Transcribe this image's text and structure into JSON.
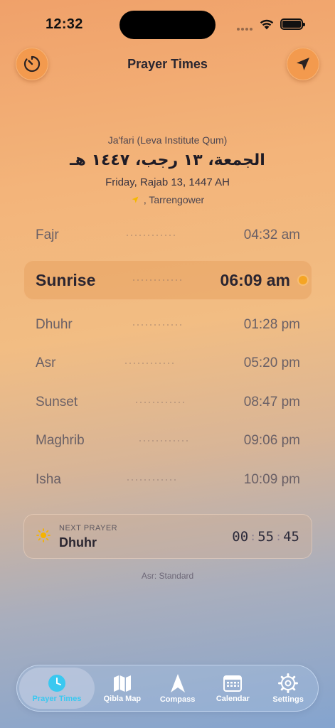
{
  "status_bar": {
    "time": "12:32"
  },
  "header": {
    "title": "Prayer Times",
    "timer_icon": "timer-icon",
    "locate_icon": "location-arrow-icon"
  },
  "info": {
    "method": "Ja'fari (Leva Institute Qum)",
    "hijri_arabic": "الجمعة، ١٣ رجب، ١٤٤٧ هـ",
    "gregorian": "Friday, Rajab 13, 1447 AH",
    "location": ", Tarrengower"
  },
  "prayers": [
    {
      "name": "Fajr",
      "time": "04:32 am"
    },
    {
      "name": "Sunrise",
      "time": "06:09 am",
      "active": true
    },
    {
      "name": "Dhuhr",
      "time": "01:28 pm"
    },
    {
      "name": "Asr",
      "time": "05:20 pm"
    },
    {
      "name": "Sunset",
      "time": "08:47 pm"
    },
    {
      "name": "Maghrib",
      "time": "09:06 pm"
    },
    {
      "name": "Isha",
      "time": "10:09 pm"
    }
  ],
  "next_prayer": {
    "label": "NEXT PRAYER",
    "name": "Dhuhr",
    "hours": "00",
    "minutes": "55",
    "seconds": "45",
    "separator": ":"
  },
  "asr_method": "Asr: Standard",
  "tabs": [
    {
      "label": "Prayer Times",
      "icon": "clock-icon",
      "selected": true
    },
    {
      "label": "Qibla Map",
      "icon": "map-icon"
    },
    {
      "label": "Compass",
      "icon": "compass-arrow-icon"
    },
    {
      "label": "Calendar",
      "icon": "calendar-icon"
    },
    {
      "label": "Settings",
      "icon": "gear-icon"
    }
  ],
  "colors": {
    "accent": "#3ac8f0",
    "sunrise_dot": "#f5a524",
    "button": "#f39a4e"
  }
}
